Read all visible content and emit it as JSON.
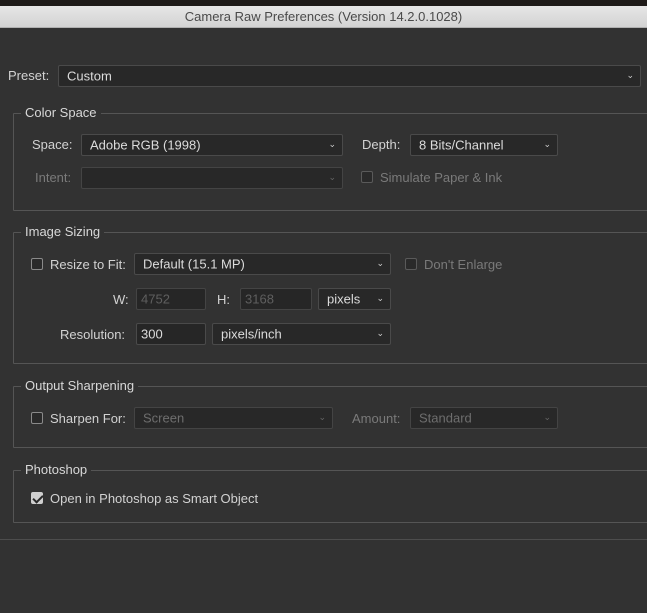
{
  "window": {
    "title": "Camera Raw Preferences  (Version 14.2.0.1028)"
  },
  "preset": {
    "label": "Preset:",
    "value": "Custom"
  },
  "color_space": {
    "legend": "Color Space",
    "space_label": "Space:",
    "space_value": "Adobe RGB (1998)",
    "depth_label": "Depth:",
    "depth_value": "8 Bits/Channel",
    "intent_label": "Intent:",
    "intent_value": "",
    "simulate_label": "Simulate Paper & Ink",
    "simulate_checked": false
  },
  "image_sizing": {
    "legend": "Image Sizing",
    "resize_label": "Resize to Fit:",
    "resize_checked": false,
    "resize_value": "Default  (15.1 MP)",
    "dont_enlarge_label": "Don't Enlarge",
    "w_label": "W:",
    "w_value": "4752",
    "h_label": "H:",
    "h_value": "3168",
    "unit_value": "pixels",
    "resolution_label": "Resolution:",
    "resolution_value": "300",
    "resolution_unit": "pixels/inch"
  },
  "output_sharpening": {
    "legend": "Output Sharpening",
    "sharpen_label": "Sharpen For:",
    "sharpen_checked": false,
    "sharpen_value": "Screen",
    "amount_label": "Amount:",
    "amount_value": "Standard"
  },
  "photoshop": {
    "legend": "Photoshop",
    "smart_object_label": "Open in Photoshop as Smart Object",
    "smart_object_checked": true
  },
  "icons": {
    "chevron": "chevron-down-icon",
    "check": "checkmark-icon"
  }
}
